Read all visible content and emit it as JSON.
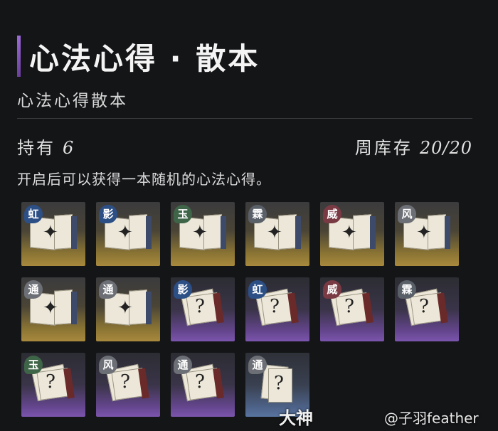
{
  "header": {
    "title": "心法心得 · 散本",
    "subtitle": "心法心得散本"
  },
  "stats": {
    "owned_label": "持有",
    "owned_value": "6",
    "weekly_label": "周库存",
    "weekly_value": "20/20"
  },
  "description": "开启后可以获得一本随机的心法心得。",
  "items": [
    {
      "badge": "虹",
      "rarity": "gold",
      "badge_color": "blue",
      "kind": "open-book"
    },
    {
      "badge": "影",
      "rarity": "gold",
      "badge_color": "blue",
      "kind": "open-book"
    },
    {
      "badge": "玉",
      "rarity": "gold",
      "badge_color": "green",
      "kind": "open-book"
    },
    {
      "badge": "霖",
      "rarity": "gold",
      "badge_color": "gray",
      "kind": "open-book"
    },
    {
      "badge": "威",
      "rarity": "gold",
      "badge_color": "red",
      "kind": "open-book"
    },
    {
      "badge": "风",
      "rarity": "gold",
      "badge_color": "silver",
      "kind": "open-book"
    },
    {
      "badge": "通",
      "rarity": "gold",
      "badge_color": "silver",
      "kind": "open-book"
    },
    {
      "badge": "通",
      "rarity": "gold",
      "badge_color": "silver",
      "kind": "open-book"
    },
    {
      "badge": "影",
      "rarity": "purple",
      "badge_color": "blue",
      "kind": "mystery-book"
    },
    {
      "badge": "虹",
      "rarity": "purple",
      "badge_color": "blue",
      "kind": "mystery-book"
    },
    {
      "badge": "威",
      "rarity": "purple",
      "badge_color": "red",
      "kind": "mystery-book"
    },
    {
      "badge": "霖",
      "rarity": "purple",
      "badge_color": "gray",
      "kind": "mystery-book"
    },
    {
      "badge": "玉",
      "rarity": "purple",
      "badge_color": "green",
      "kind": "mystery-book"
    },
    {
      "badge": "风",
      "rarity": "purple",
      "badge_color": "silver",
      "kind": "mystery-book"
    },
    {
      "badge": "通",
      "rarity": "purple",
      "badge_color": "silver",
      "kind": "mystery-book"
    },
    {
      "badge": "通",
      "rarity": "blue",
      "badge_color": "silver",
      "kind": "mystery-paper"
    }
  ],
  "watermark": {
    "brand": "大神",
    "user": "@子羽feather"
  }
}
